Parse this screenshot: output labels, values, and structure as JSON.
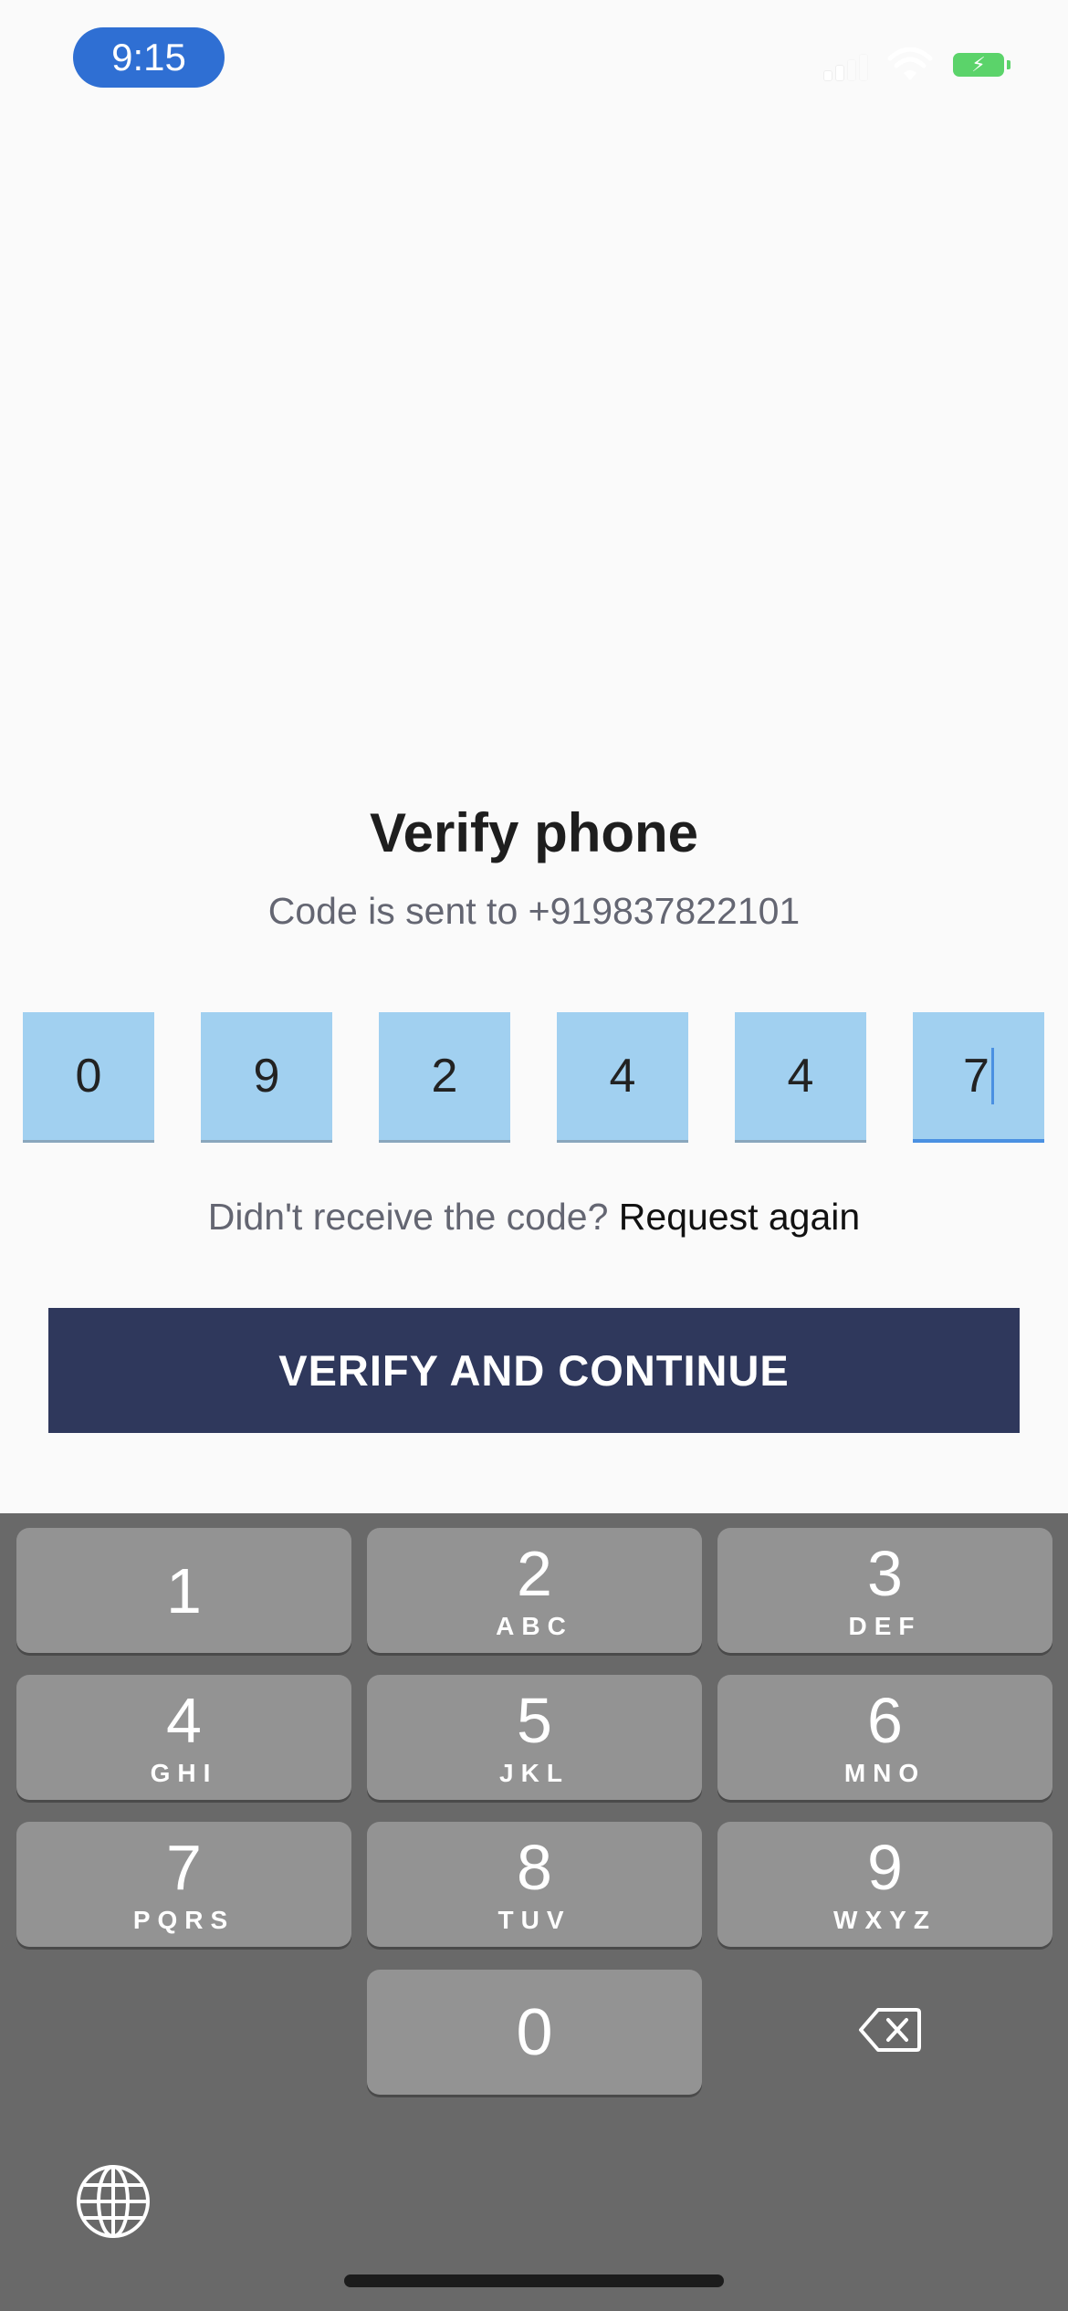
{
  "status_bar": {
    "time": "9:15"
  },
  "screen": {
    "title": "Verify phone",
    "subtitle": "Code is sent to +919837822101",
    "otp_digits": [
      "0",
      "9",
      "2",
      "4",
      "4",
      "7"
    ],
    "resend_prompt": "Didn't receive the code?",
    "resend_link": "Request again",
    "verify_button": "VERIFY AND CONTINUE"
  },
  "keyboard": {
    "keys": [
      {
        "num": "1",
        "letters": ""
      },
      {
        "num": "2",
        "letters": "ABC"
      },
      {
        "num": "3",
        "letters": "DEF"
      },
      {
        "num": "4",
        "letters": "GHI"
      },
      {
        "num": "5",
        "letters": "JKL"
      },
      {
        "num": "6",
        "letters": "MNO"
      },
      {
        "num": "7",
        "letters": "PQRS"
      },
      {
        "num": "8",
        "letters": "TUV"
      },
      {
        "num": "9",
        "letters": "WXYZ"
      },
      {
        "num": "0",
        "letters": ""
      }
    ]
  },
  "colors": {
    "otp_box": "#a1d0f0",
    "button": "#2f385c",
    "status_pill": "#2f6fd3",
    "keyboard_bg": "#696969",
    "key_bg": "#939393"
  }
}
